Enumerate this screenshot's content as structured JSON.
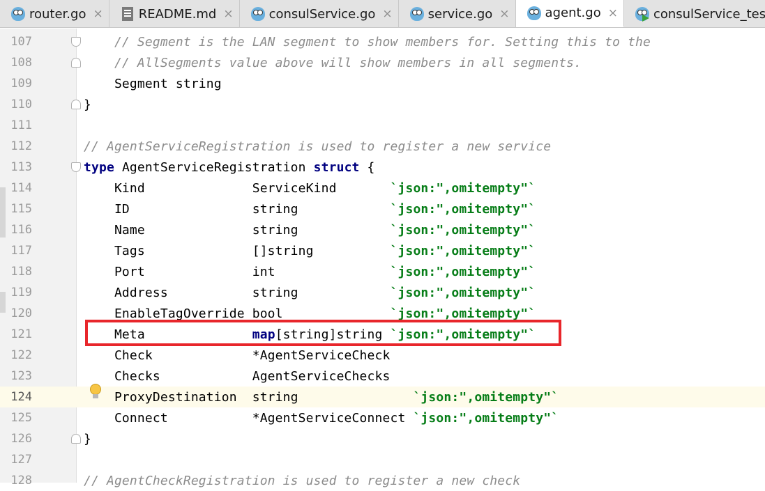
{
  "tabs": [
    {
      "label": "router.go",
      "icon": "gopher-icon",
      "active": false
    },
    {
      "label": "README.md",
      "icon": "markdown-file-icon",
      "active": false
    },
    {
      "label": "consulService.go",
      "icon": "gopher-icon",
      "active": false
    },
    {
      "label": "service.go",
      "icon": "gopher-icon",
      "active": false
    },
    {
      "label": "agent.go",
      "icon": "gopher-icon",
      "active": true
    },
    {
      "label": "consulService_test.go",
      "icon": "gopher-test-icon",
      "active": false
    }
  ],
  "close_glyph": "×",
  "line_numbers": [
    "107",
    "108",
    "109",
    "110",
    "111",
    "112",
    "113",
    "114",
    "115",
    "116",
    "117",
    "118",
    "119",
    "120",
    "121",
    "122",
    "123",
    "124",
    "125",
    "126",
    "127",
    "128"
  ],
  "current_line": "124",
  "highlighted_line": "121",
  "code": {
    "l107": "    // Segment is the LAN segment to show members for. Setting this to the",
    "l108": "    // AllSegments value above will show members in all segments.",
    "l109": "    Segment string",
    "l110": "}",
    "l112": "// AgentServiceRegistration is used to register a new service",
    "l113_kw1": "type",
    "l113_name": " AgentServiceRegistration ",
    "l113_kw2": "struct",
    "l113_tail": " {",
    "l114_a": "    Kind              ServiceKind       ",
    "l114_tag": "`json:\",omitempty\"`",
    "l115_a": "    ID                string            ",
    "l115_tag": "`json:\",omitempty\"`",
    "l116_a": "    Name              string            ",
    "l116_tag": "`json:\",omitempty\"`",
    "l117_a": "    Tags              []string          ",
    "l117_tag": "`json:\",omitempty\"`",
    "l118_a": "    Port              int               ",
    "l118_tag": "`json:\",omitempty\"`",
    "l119_a": "    Address           string            ",
    "l119_tag": "`json:\",omitempty\"`",
    "l120_a": "    EnableTagOverride bool              ",
    "l120_tag": "`json:\",omitempty\"`",
    "l121_a": "    Meta              ",
    "l121_kw": "map",
    "l121_b": "[string]string ",
    "l121_tag": "`json:\",omitempty\"`",
    "l122": "    Check             *AgentServiceCheck",
    "l123": "    Checks            AgentServiceChecks",
    "l124_a": "    ProxyDestination  string               ",
    "l124_tag": "`json:\",omitempty\"`",
    "l125_a": "    Connect           *AgentServiceConnect ",
    "l125_tag": "`json:\",omitempty\"`",
    "l126": "}",
    "l128": "// AgentCheckRegistration is used to register a new check"
  },
  "colors": {
    "comment": "#8c8c8c",
    "keyword": "#000080",
    "struct_tag": "#067d17",
    "highlight_box": "#e8262b",
    "current_line_bg": "#fefbea"
  }
}
